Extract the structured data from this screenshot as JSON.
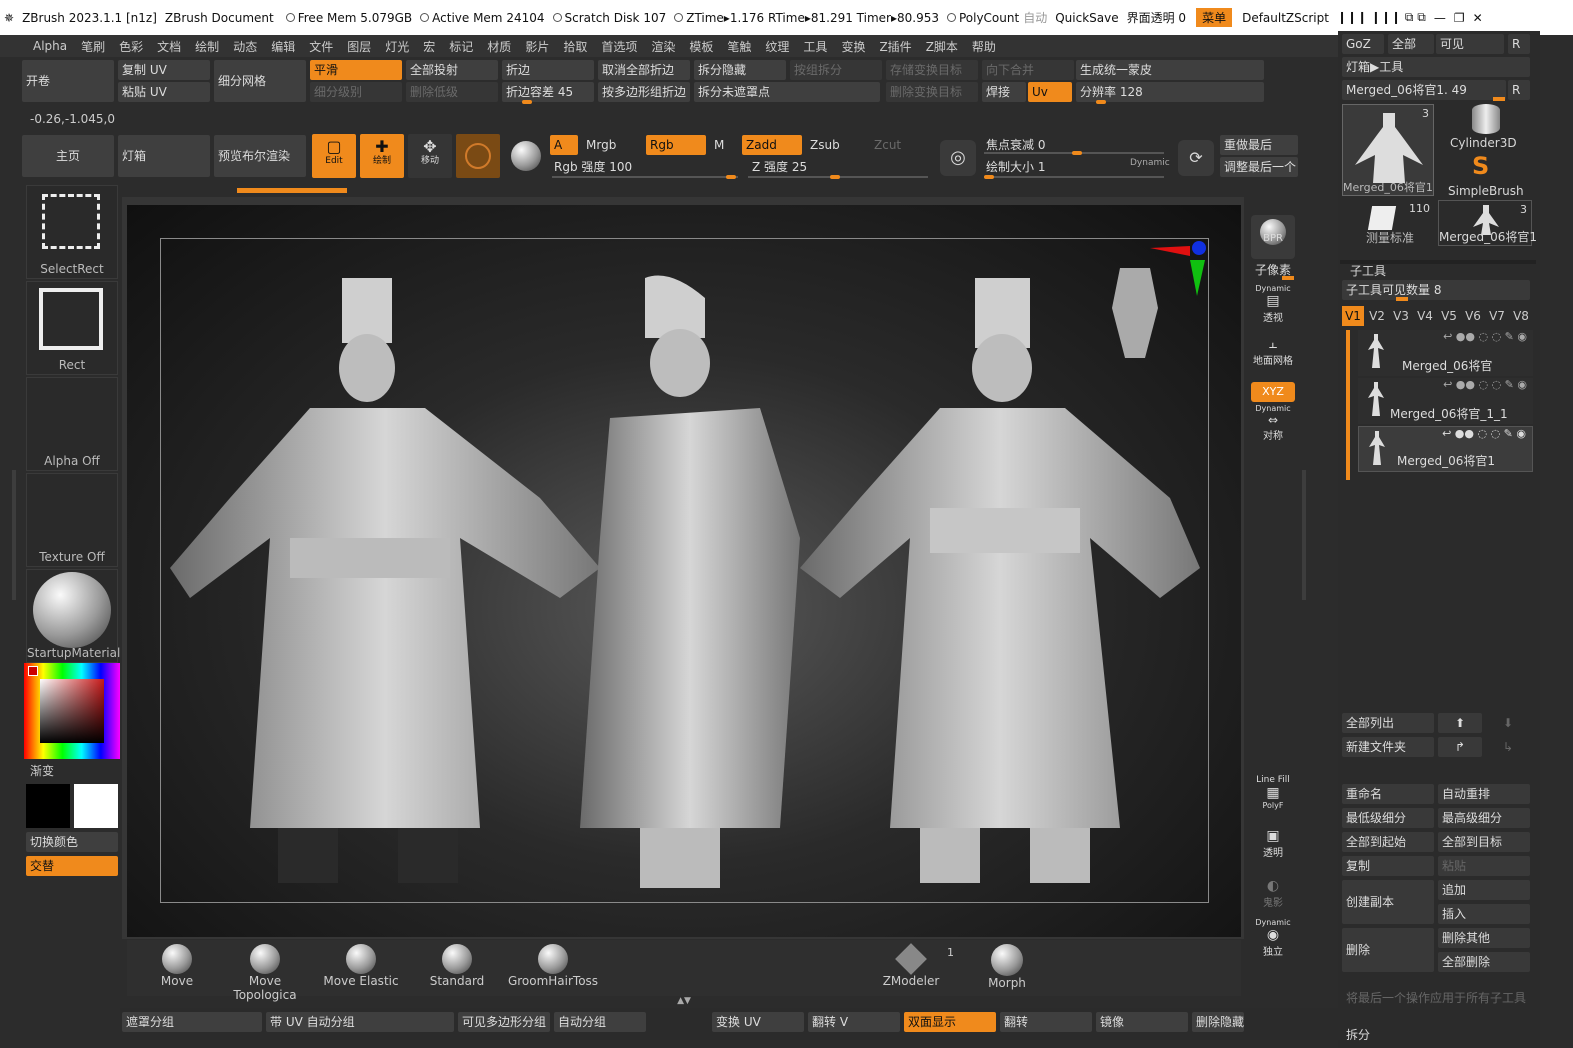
{
  "titlebar": {
    "app": "ZBrush 2023.1.1 [n1z]",
    "document": "ZBrush Document",
    "free_mem": "Free Mem 5.079GB",
    "active_mem": "Active Mem 24104",
    "scratch": "Scratch Disk 107",
    "ztime": "ZTime▸1.176 RTime▸81.291 Timer▸80.953",
    "polycount": "PolyCount",
    "auto": "自动",
    "quicksave": "QuickSave",
    "opacity": "界面透明 0",
    "menu": "菜单",
    "script": "DefaultZScript"
  },
  "menubar": [
    "Alpha",
    "笔刷",
    "色彩",
    "文档",
    "绘制",
    "动态",
    "编辑",
    "文件",
    "图层",
    "灯光",
    "宏",
    "标记",
    "材质",
    "影片",
    "拾取",
    "首选项",
    "渲染",
    "模板",
    "笔触",
    "纹理",
    "工具",
    "变换",
    "Z插件",
    "Z脚本",
    "帮助"
  ],
  "toolbar1": {
    "open": "开卷",
    "copy_uv": "复制 UV",
    "paste_uv": "粘贴 UV",
    "subdiv_mesh": "细分网格",
    "smooth": "平滑",
    "subdiv_level": "细分级别",
    "project_all": "全部投射",
    "del_lower": "删除低级",
    "crease": "折边",
    "crease_tol": "折边容差 45",
    "uncrease_all": "取消全部折边",
    "crease_pg": "按多边形组折边",
    "split_hidden": "拆分隐藏",
    "split_unmasked": "拆分未遮罩点",
    "group_split": "按组拆分",
    "store_morph": "存储变换目标",
    "del_morph": "删除变换目标",
    "merge_down": "向下合并",
    "weld": "焊接",
    "uv": "Uv",
    "unify_skin": "生成统一蒙皮",
    "resolution": "分辨率 128"
  },
  "coords": "-0.26,-1.045,0",
  "toolbar2": {
    "home": "主页",
    "lightbox": "灯箱",
    "preview_bool": "预览布尔渲染",
    "edit": "Edit",
    "draw": "绘制",
    "move": "移动",
    "a": "A",
    "mrgb": "Mrgb",
    "rgb": "Rgb",
    "m": "M",
    "rgb_int": "Rgb 强度 100",
    "zadd": "Zadd",
    "zsub": "Zsub",
    "zcut": "Zcut",
    "z_int": "Z 强度 25",
    "focal": "焦点衰减 0",
    "draw_size": "绘制大小 1",
    "dynamic": "Dynamic",
    "redo_last": "重做最后",
    "adjust_last": "调整最后一个"
  },
  "leftpanel": {
    "select_rect": "SelectRect",
    "rect": "Rect",
    "alpha_off": "Alpha Off",
    "texture_off": "Texture Off",
    "material": "StartupMaterial",
    "gradient": "渐变",
    "switch_color": "切换颜色",
    "alternate": "交替"
  },
  "sideicons": {
    "bpr": "BPR",
    "subpixel": "子像素",
    "persp_dyn": "Dynamic",
    "persp": "透视",
    "floor": "地面网格",
    "xyz": "XYZ",
    "sym_dyn": "Dynamic",
    "sym": "对称",
    "linefill": "Line Fill",
    "polyf": "PolyF",
    "transp": "透明",
    "ghost": "鬼影",
    "solo_dyn": "Dynamic",
    "solo": "独立"
  },
  "rightpanel": {
    "goz": "GoZ",
    "all": "全部",
    "visible": "可见",
    "r": "R",
    "lightbox_tool": "灯箱▶工具",
    "current_tool": "Merged_06将官1. 49",
    "tools": [
      {
        "name": "Merged_06将官1",
        "count": "3"
      },
      {
        "name": "Cylinder3D",
        "count": ""
      },
      {
        "name": "SimpleBrush",
        "count": ""
      },
      {
        "name": "测量标准",
        "count": "110"
      },
      {
        "name": "Merged_06将官1",
        "count": "3"
      }
    ],
    "subtool_title": "子工具",
    "subtool_visible": "子工具可见数量 8",
    "vtabs": [
      "V1",
      "V2",
      "V3",
      "V4",
      "V5",
      "V6",
      "V7",
      "V8"
    ],
    "subtools": [
      "Merged_06将官",
      "Merged_06将官_1_1",
      "Merged_06将官1"
    ],
    "list_all": "全部列出",
    "new_folder": "新建文件夹",
    "rename": "重命名",
    "auto_reorder": "自动重排",
    "lowest_sub": "最低级细分",
    "highest_sub": "最高级细分",
    "all_to_start": "全部到起始",
    "all_to_target": "全部到目标",
    "copy": "复制",
    "paste": "粘贴",
    "duplicate": "创建副本",
    "append": "追加",
    "insert": "插入",
    "delete": "删除",
    "delete_other": "删除其他",
    "delete_all": "全部删除",
    "apply_last": "将最后一个操作应用于所有子工具",
    "split": "拆分"
  },
  "brushes": [
    {
      "name": "Move"
    },
    {
      "name": "Move Topologica"
    },
    {
      "name": "Move Elastic"
    },
    {
      "name": "Standard"
    },
    {
      "name": "GroomHairToss"
    }
  ],
  "zmodeler": {
    "name": "ZModeler",
    "count": "1"
  },
  "morph": "Morph",
  "bottombar": {
    "mask_group": "遮罩分组",
    "uv_autogroup": "带 UV 自动分组",
    "visible_pg": "可见多边形分组",
    "autogroup": "自动分组",
    "morph_uv": "变换 UV",
    "flip_v": "翻转 V",
    "double": "双面显示",
    "flip": "翻转",
    "mirror": "镜像",
    "del_hidden": "删除隐藏"
  },
  "colors": {
    "accent": "#f08a1c",
    "panel": "#3f3f3f",
    "bg": "#2c2c2c"
  }
}
